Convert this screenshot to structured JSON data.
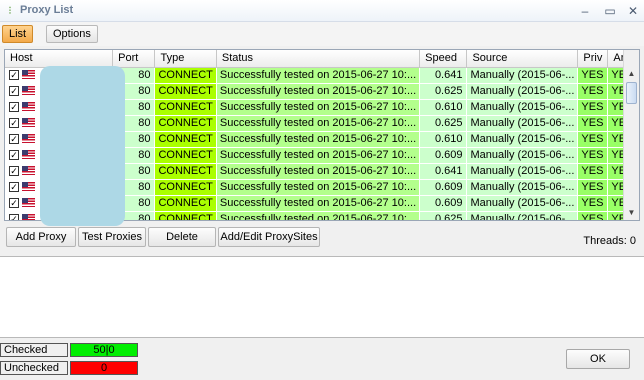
{
  "window": {
    "title": "Proxy List"
  },
  "toolbar": {
    "tabs": [
      {
        "label": "List"
      },
      {
        "label": "Options"
      }
    ]
  },
  "table": {
    "columns": [
      "Host",
      "Port",
      "Type",
      "Status",
      "Speed",
      "Source",
      "Priv",
      "Ano"
    ],
    "rows": [
      {
        "host_tail": "...",
        "port": "80",
        "type": "CONNECT",
        "status": "Successfully tested on 2015-06-27 10:...",
        "speed": "0.641",
        "source": "Manually (2015-06-...",
        "priv": "YES",
        "ano": "YES"
      },
      {
        "host_tail": "...",
        "port": "80",
        "type": "CONNECT",
        "status": "Successfully tested on 2015-06-27 10:...",
        "speed": "0.625",
        "source": "Manually (2015-06-...",
        "priv": "YES",
        "ano": "YES"
      },
      {
        "host_tail": "...",
        "port": "80",
        "type": "CONNECT",
        "status": "Successfully tested on 2015-06-27 10:...",
        "speed": "0.610",
        "source": "Manually (2015-06-...",
        "priv": "YES",
        "ano": "YES"
      },
      {
        "host_tail": "...",
        "port": "80",
        "type": "CONNECT",
        "status": "Successfully tested on 2015-06-27 10:...",
        "speed": "0.625",
        "source": "Manually (2015-06-...",
        "priv": "YES",
        "ano": "YES"
      },
      {
        "host_tail": "...",
        "port": "80",
        "type": "CONNECT",
        "status": "Successfully tested on 2015-06-27 10:...",
        "speed": "0.610",
        "source": "Manually (2015-06-...",
        "priv": "YES",
        "ano": "YES"
      },
      {
        "host_tail": "...",
        "port": "80",
        "type": "CONNECT",
        "status": "Successfully tested on 2015-06-27 10:...",
        "speed": "0.609",
        "source": "Manually (2015-06-...",
        "priv": "YES",
        "ano": "YES"
      },
      {
        "host_tail": "...",
        "port": "80",
        "type": "CONNECT",
        "status": "Successfully tested on 2015-06-27 10:...",
        "speed": "0.641",
        "source": "Manually (2015-06-...",
        "priv": "YES",
        "ano": "YES"
      },
      {
        "host_tail": "...",
        "port": "80",
        "type": "CONNECT",
        "status": "Successfully tested on 2015-06-27 10:...",
        "speed": "0.609",
        "source": "Manually (2015-06-...",
        "priv": "YES",
        "ano": "YES"
      },
      {
        "host_tail": "...",
        "port": "80",
        "type": "CONNECT",
        "status": "Successfully tested on 2015-06-27 10:...",
        "speed": "0.609",
        "source": "Manually (2015-06-...",
        "priv": "YES",
        "ano": "YES"
      },
      {
        "host_tail": "...",
        "port": "80",
        "type": "CONNECT",
        "status": "Successfully tested on 2015-06-27 10:...",
        "speed": "0.625",
        "source": "Manually (2015-06-...",
        "priv": "YES",
        "ano": "YES"
      }
    ]
  },
  "actions": {
    "add_proxy": "Add Proxy",
    "test_proxies": "Test Proxies",
    "delete": "Delete",
    "add_edit_sites": "Add/Edit ProxySites"
  },
  "threads": "Threads: 0",
  "stats": {
    "checked_label": "Checked",
    "checked_value": "50|0",
    "checked_color": "#00ee00",
    "unchecked_label": "Unchecked",
    "unchecked_value": "0",
    "unchecked_color": "#ff0000"
  },
  "ok_label": "OK",
  "colors": {
    "row_green": "#ccffcc",
    "type_green": "#aaff00",
    "yes_green": "#99ff66",
    "accent_orange": "#f3a94a"
  },
  "icons": {
    "app": "proxy-icon",
    "flag": "us-flag-icon",
    "minimize": "minimize-icon",
    "maximize": "maximize-icon",
    "close": "close-icon"
  }
}
